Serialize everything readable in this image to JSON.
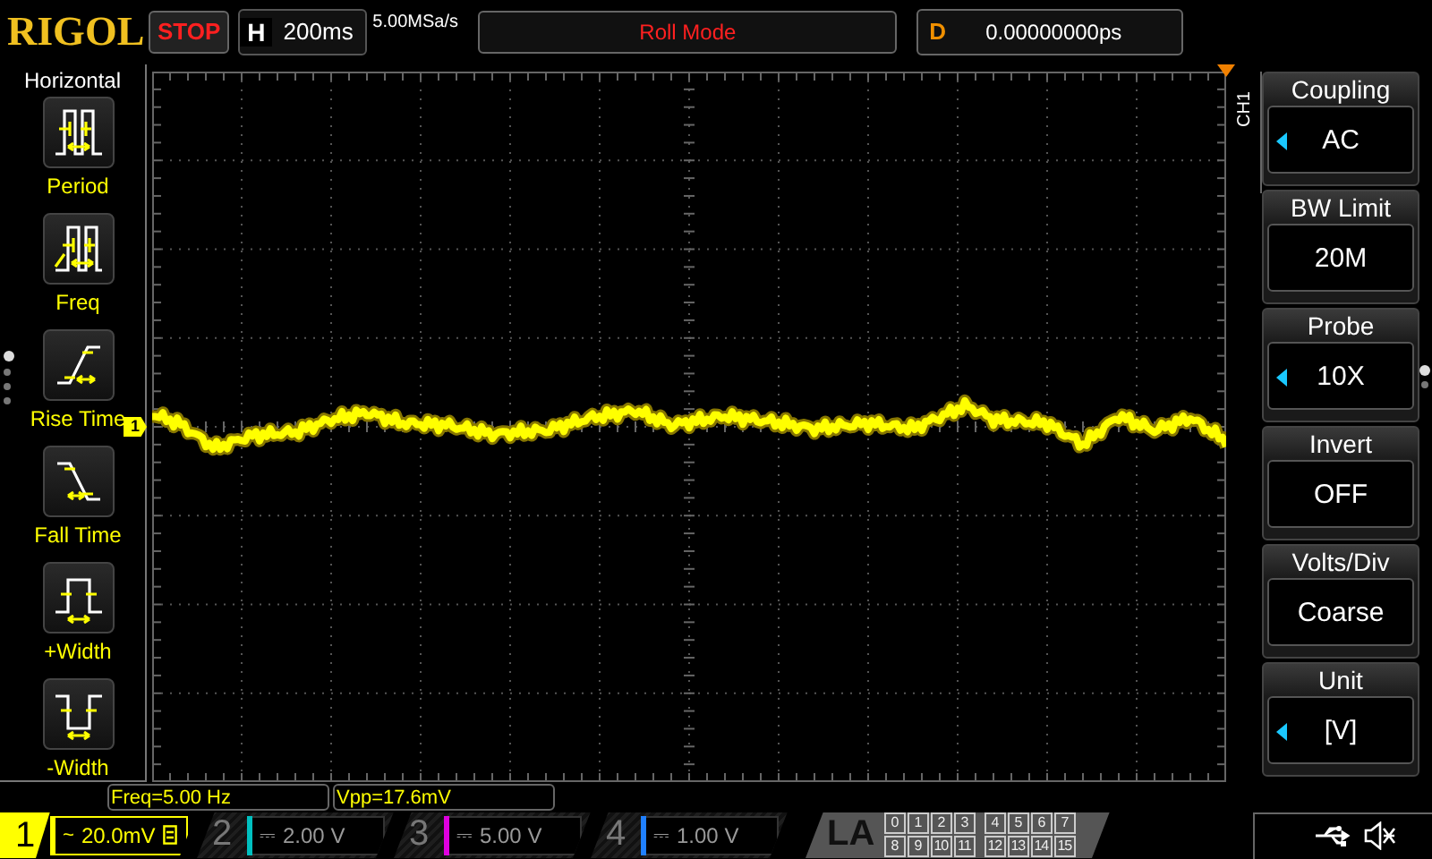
{
  "header": {
    "logo": "RIGOL",
    "run_state": "STOP",
    "timebase_label": "H",
    "timebase": "200ms",
    "sample_rate": "5.00MSa/s",
    "mode": "Roll Mode",
    "delay_label": "D",
    "delay": "0.00000000ps"
  },
  "left_menu": {
    "title": "Horizontal",
    "items": [
      {
        "kind": "period",
        "label": "Period"
      },
      {
        "kind": "freq",
        "label": "Freq"
      },
      {
        "kind": "rise",
        "label": "Rise Time"
      },
      {
        "kind": "fall",
        "label": "Fall Time"
      },
      {
        "kind": "pwidth",
        "label": "+Width"
      },
      {
        "kind": "nwidth",
        "label": "-Width"
      }
    ],
    "pages": [
      {
        "selected": true
      },
      {
        "selected": false
      },
      {
        "selected": false
      },
      {
        "selected": false
      }
    ]
  },
  "trace_marker": "1",
  "channel_tab": "CH1",
  "right_menu": {
    "items": [
      {
        "title": "Coupling",
        "value": "AC",
        "adjustable": true
      },
      {
        "title": "BW Limit",
        "value": "20M",
        "adjustable": false
      },
      {
        "title": "Probe",
        "value": "10X",
        "adjustable": true
      },
      {
        "title": "Invert",
        "value": "OFF",
        "adjustable": false
      },
      {
        "title": "Volts/Div",
        "value": "Coarse",
        "adjustable": false
      },
      {
        "title": "Unit",
        "value": "[V]",
        "adjustable": true
      }
    ],
    "pages": [
      {
        "selected": true
      },
      {
        "selected": false
      }
    ]
  },
  "measurements": [
    "Freq=5.00 Hz",
    "Vpp=17.6mV"
  ],
  "channels": [
    {
      "number": "1",
      "scale": "20.0mV",
      "coupling": "~",
      "bw_limit": true,
      "active": true,
      "color": "#ffff00"
    },
    {
      "number": "2",
      "scale": "2.00 V",
      "coupling": "⎓",
      "bw_limit": false,
      "active": false,
      "color": "#00c0c0"
    },
    {
      "number": "3",
      "scale": "5.00 V",
      "coupling": "⎓",
      "bw_limit": false,
      "active": false,
      "color": "#e000e0"
    },
    {
      "number": "4",
      "scale": "1.00 V",
      "coupling": "⎓",
      "bw_limit": false,
      "active": false,
      "color": "#2080ff"
    }
  ],
  "la": {
    "label": "LA",
    "groups": [
      {
        "rows": [
          [
            "0",
            "1",
            "2",
            "3"
          ],
          [
            "8",
            "9",
            "10",
            "11"
          ]
        ]
      },
      {
        "rows": [
          [
            "4",
            "5",
            "6",
            "7"
          ],
          [
            "12",
            "13",
            "14",
            "15"
          ]
        ]
      }
    ]
  }
}
